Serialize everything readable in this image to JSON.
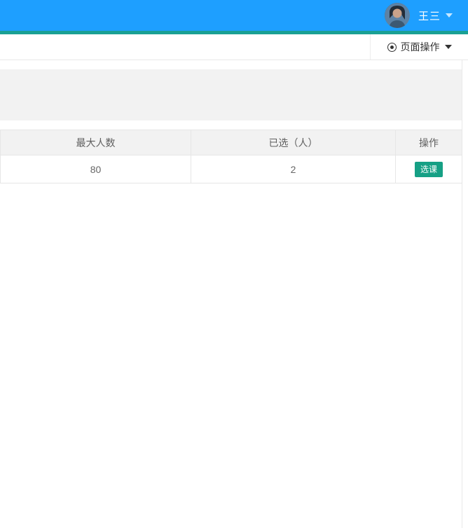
{
  "navbar": {
    "username": "王三"
  },
  "toolbar": {
    "page_actions": "页面操作"
  },
  "table": {
    "columns": [
      "最大人数",
      "已选（人）",
      "操作"
    ],
    "row": {
      "max_people": "80",
      "selected_people": "2",
      "action": "选课"
    }
  },
  "colors": {
    "navbar_blue": "#1E9FFF",
    "accent_teal": "#1AA094",
    "button_green": "#16A085",
    "header_bg": "#F2F2F2",
    "table_border": "#E6E6E6",
    "text_gray": "#666666"
  }
}
